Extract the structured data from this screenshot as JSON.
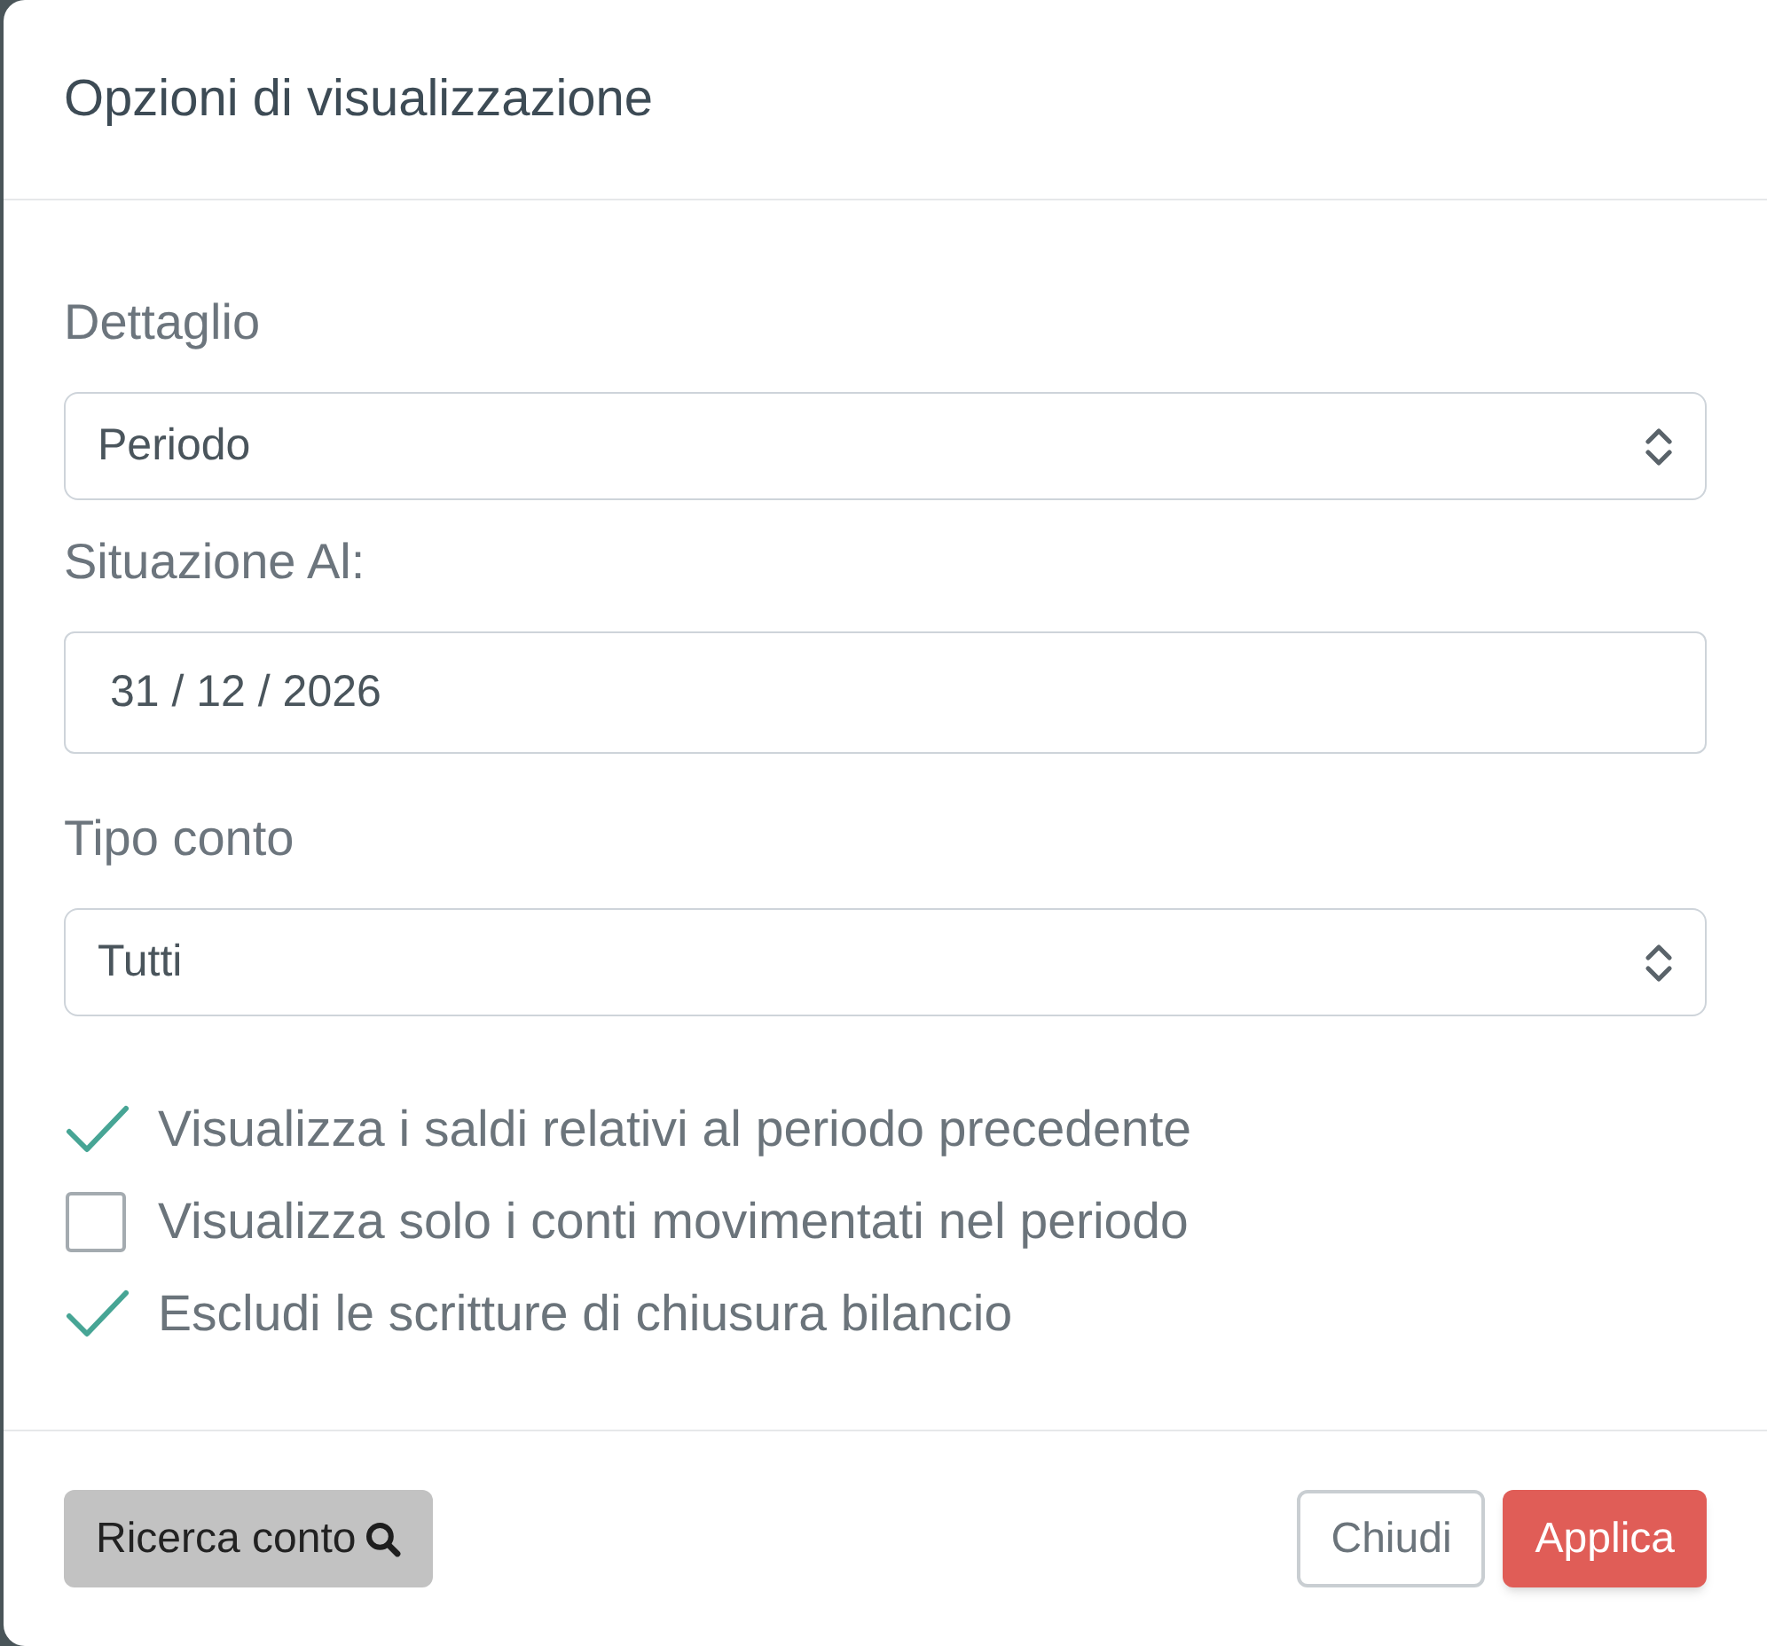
{
  "dialog": {
    "title": "Opzioni di visualizzazione"
  },
  "fields": [
    {
      "kind": "select",
      "label": "Dettaglio",
      "value": "Periodo"
    },
    {
      "kind": "date",
      "label": "Situazione Al:",
      "value": "31 / 12 / 2026"
    },
    {
      "kind": "select",
      "label": "Tipo conto",
      "value": "Tutti"
    }
  ],
  "options": [
    {
      "label": "Visualizza i saldi relativi al periodo precedente",
      "checked": true
    },
    {
      "label": "Visualizza solo i conti movimentati nel periodo",
      "checked": false
    },
    {
      "label": "Escludi le scritture di chiusura bilancio",
      "checked": true
    }
  ],
  "buttons": [
    {
      "kind": "search",
      "label": "Ricerca conto"
    },
    {
      "kind": "outline",
      "label": "Chiudi"
    },
    {
      "kind": "primary",
      "label": "Applica"
    }
  ]
}
